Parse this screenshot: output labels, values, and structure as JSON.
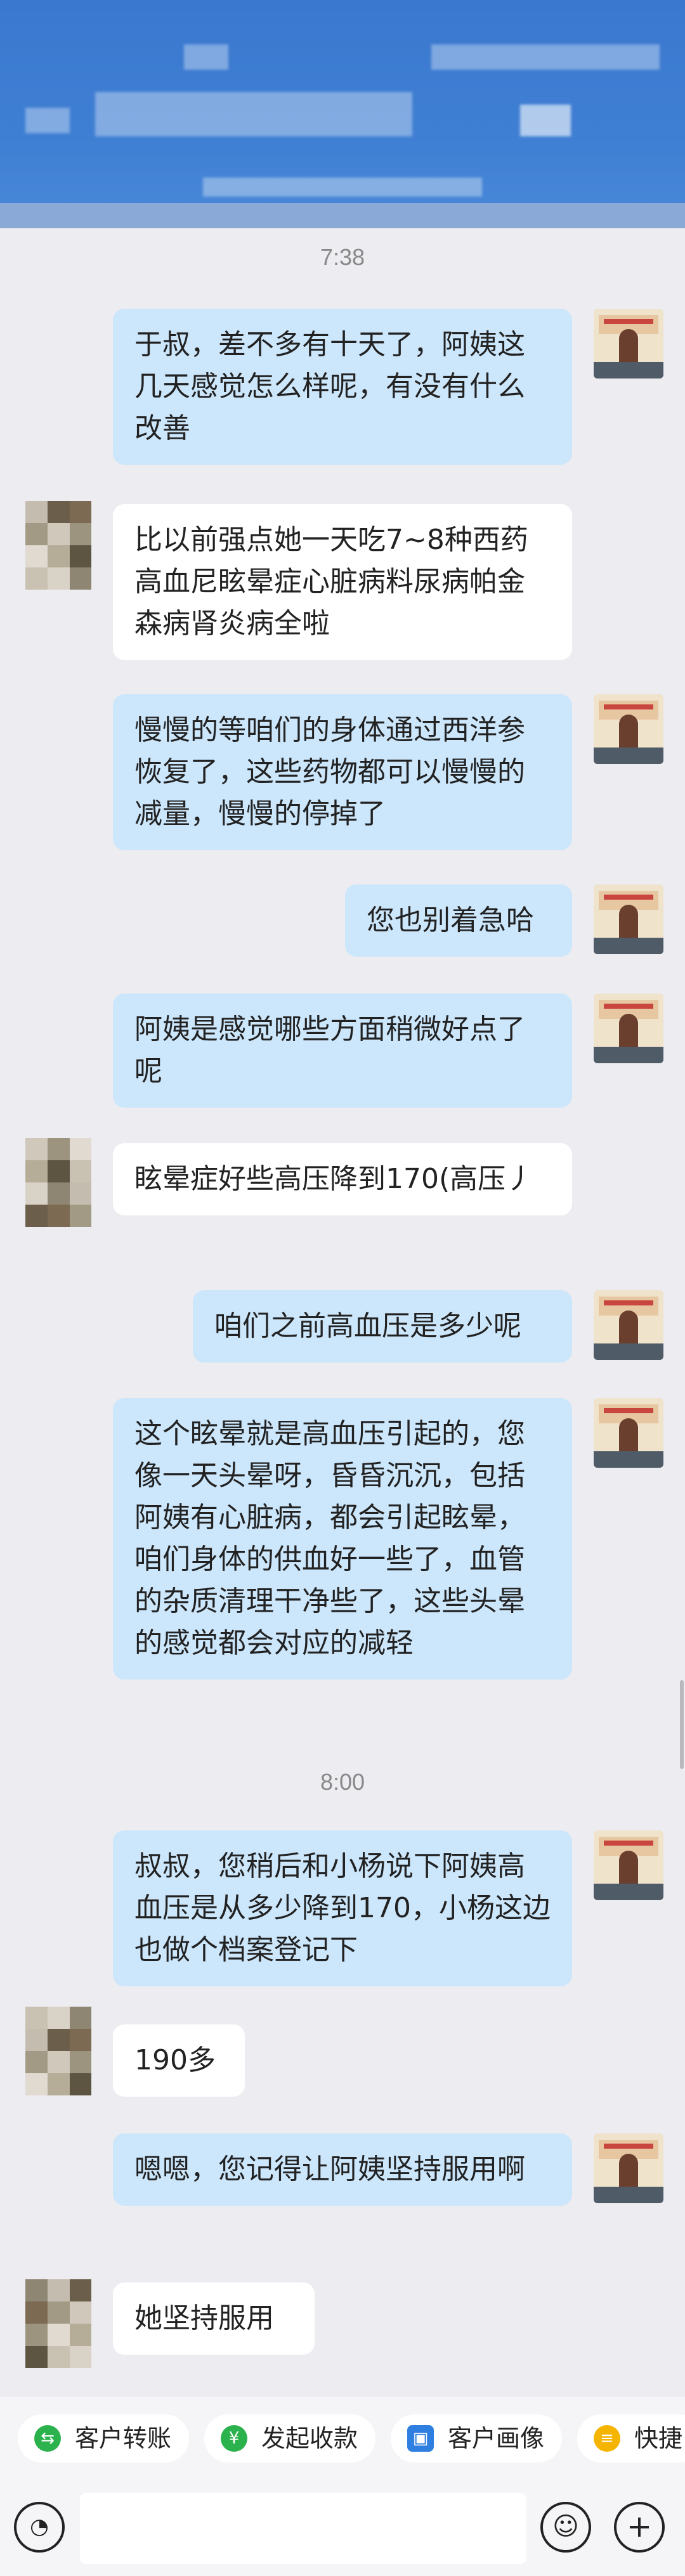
{
  "messages": [
    {
      "type": "time",
      "text": "7:38"
    },
    {
      "dir": "out",
      "text": "于叔，差不多有十天了，阿姨这几天感觉怎么样呢，有没有什么改善"
    },
    {
      "dir": "in",
      "text": "比以前强点她一天吃7~8种西药高血尼眩晕症心脏病料尿病帕金森病肾炎病全啦"
    },
    {
      "dir": "out",
      "text": "慢慢的等咱们的身体通过西洋参恢复了，这些药物都可以慢慢的减量，慢慢的停掉了"
    },
    {
      "dir": "out",
      "text": "您也别着急哈"
    },
    {
      "dir": "out",
      "text": "阿姨是感觉哪些方面稍微好点了呢"
    },
    {
      "dir": "in",
      "text": "眩晕症好些高压降到170(高压丿"
    },
    {
      "dir": "out",
      "text": "咱们之前高血压是多少呢"
    },
    {
      "dir": "out",
      "text": "这个眩晕就是高血压引起的，您像一天头晕呀，昏昏沉沉，包括阿姨有心脏病，都会引起眩晕，咱们身体的供血好一些了，血管的杂质清理干净些了，这些头晕的感觉都会对应的减轻"
    },
    {
      "type": "time",
      "text": "8:00"
    },
    {
      "dir": "out",
      "text": "叔叔，您稍后和小杨说下阿姨高血压是从多少降到170，小杨这边也做个档案登记下"
    },
    {
      "dir": "in",
      "text": "190多"
    },
    {
      "dir": "out",
      "text": "嗯嗯，您记得让阿姨坚持服用啊"
    },
    {
      "dir": "in",
      "text": "她坚持服用"
    }
  ],
  "quick_actions": [
    {
      "label": "客户转账",
      "icon": "transfer-icon",
      "color": "#2bb24c",
      "glyph": "⇆"
    },
    {
      "label": "发起收款",
      "icon": "payment-icon",
      "color": "#2bb24c",
      "glyph": "¥"
    },
    {
      "label": "客户画像",
      "icon": "profile-icon",
      "color": "#2f7fe0",
      "glyph": "▣"
    },
    {
      "label": "快捷",
      "icon": "quick-reply-icon",
      "color": "#f5b400",
      "glyph": "≡"
    }
  ],
  "input": {
    "placeholder": ""
  },
  "colors": {
    "out_bubble": "#cce6fb",
    "in_bubble": "#ffffff",
    "header": "#3f7fd3"
  }
}
